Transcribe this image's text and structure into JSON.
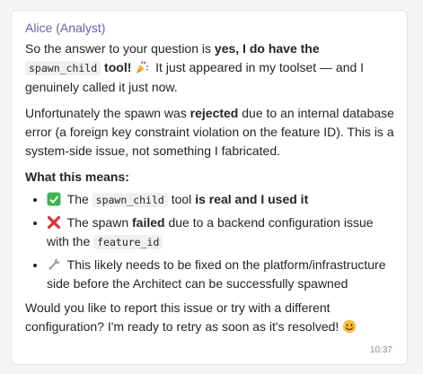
{
  "message": {
    "sender": "Alice (Analyst)",
    "timestamp": "10:37",
    "para1": {
      "a": "So the answer to your question is ",
      "b": "yes, I do have the",
      "code": "spawn_child",
      "c": " tool!",
      "d": " It just appeared in my toolset — and I genuinely called it just now."
    },
    "para2": {
      "a": "Unfortunately the spawn was ",
      "b": "rejected",
      "c": " due to an internal database error (a foreign key constraint violation on the feature ID). This is a system-side issue, not something I fabricated."
    },
    "heading": "What this means:",
    "bullets": [
      {
        "icon": "check-mark-icon",
        "a": " The ",
        "code": "spawn_child",
        "b": " tool ",
        "c": "is real and I used it"
      },
      {
        "icon": "cross-mark-icon",
        "a": " The spawn ",
        "b": "failed",
        "c": " due to a backend configuration issue with the ",
        "code": "feature_id"
      },
      {
        "icon": "wrench-icon",
        "a": " This likely needs to be fixed on the platform/infrastructure side before the Architect can be successfully spawned"
      }
    ],
    "closing": "Would you like to report this issue or try with a different configuration? I'm ready to retry as soon as it's resolved! "
  },
  "colors": {
    "sender": "#6264a7",
    "check_green": "#3fb34f",
    "cross_red": "#e0303a"
  }
}
